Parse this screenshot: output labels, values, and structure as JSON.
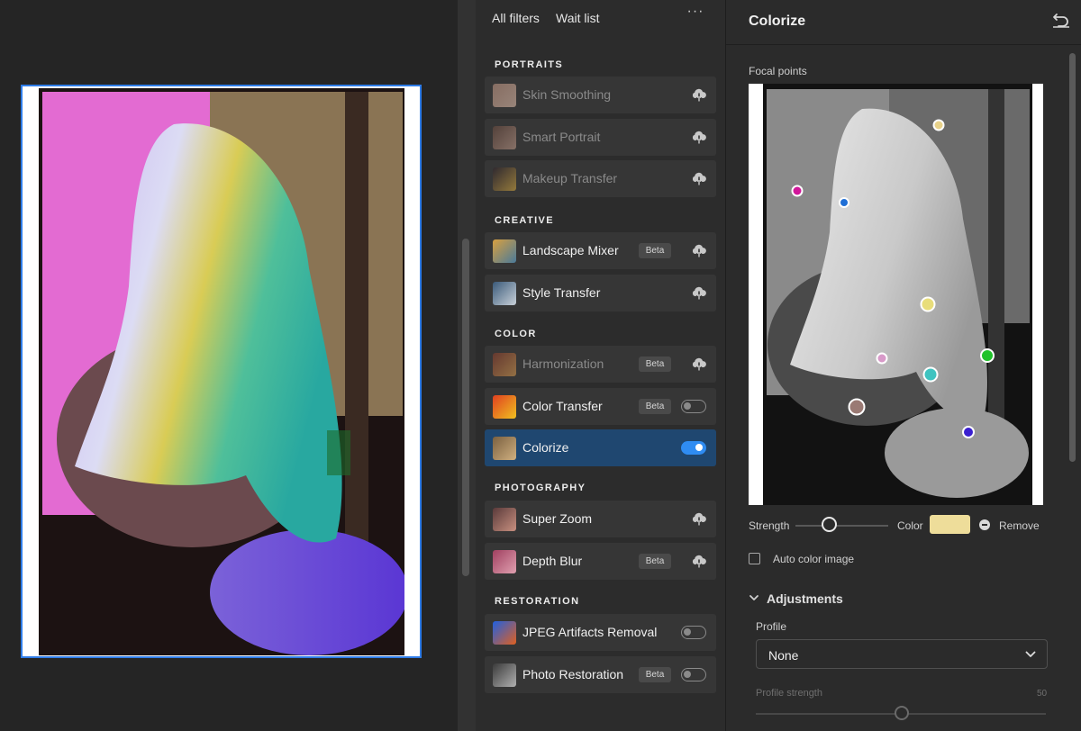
{
  "filters_panel": {
    "tabs": [
      "All filters",
      "Wait list"
    ],
    "more_label": "···",
    "sections": [
      {
        "label": "PORTRAITS",
        "items": [
          {
            "name": "Skin Smoothing",
            "beta": false,
            "control": "cloud",
            "state": "disabled"
          },
          {
            "name": "Smart Portrait",
            "beta": false,
            "control": "cloud",
            "state": "disabled"
          },
          {
            "name": "Makeup Transfer",
            "beta": false,
            "control": "cloud",
            "state": "disabled"
          }
        ]
      },
      {
        "label": "CREATIVE",
        "items": [
          {
            "name": "Landscape Mixer",
            "beta": true,
            "control": "cloud",
            "state": "enabled"
          },
          {
            "name": "Style Transfer",
            "beta": false,
            "control": "cloud",
            "state": "enabled"
          }
        ]
      },
      {
        "label": "COLOR",
        "items": [
          {
            "name": "Harmonization",
            "beta": true,
            "control": "cloud",
            "state": "disabled"
          },
          {
            "name": "Color Transfer",
            "beta": true,
            "control": "toggle",
            "toggle_on": false,
            "state": "enabled"
          },
          {
            "name": "Colorize",
            "beta": false,
            "control": "toggle",
            "toggle_on": true,
            "state": "active"
          }
        ]
      },
      {
        "label": "PHOTOGRAPHY",
        "items": [
          {
            "name": "Super Zoom",
            "beta": false,
            "control": "cloud",
            "state": "enabled"
          },
          {
            "name": "Depth Blur",
            "beta": true,
            "control": "cloud",
            "state": "enabled"
          }
        ]
      },
      {
        "label": "RESTORATION",
        "items": [
          {
            "name": "JPEG Artifacts Removal",
            "beta": false,
            "control": "toggle",
            "toggle_on": false,
            "state": "enabled"
          },
          {
            "name": "Photo Restoration",
            "beta": true,
            "control": "toggle",
            "toggle_on": false,
            "state": "enabled"
          }
        ]
      }
    ],
    "beta_label": "Beta"
  },
  "colorize_panel": {
    "title": "Colorize",
    "focal_points_label": "Focal points",
    "focal_points": [
      {
        "color": "#e8d28a"
      },
      {
        "color": "#d1169a"
      },
      {
        "color": "#1f6fd6"
      },
      {
        "color": "#e8dd7a"
      },
      {
        "color": "#d89ac9"
      },
      {
        "color": "#3fc3c0"
      },
      {
        "color": "#20c22a"
      },
      {
        "color": "#9a7a74"
      },
      {
        "color": "#3a1fd0"
      }
    ],
    "strength_label": "Strength",
    "strength_level": 0.36,
    "color_label": "Color",
    "selected_color": "#eedd9a",
    "remove_label": "Remove",
    "auto_color_label": "Auto color image",
    "auto_color_checked": false,
    "adjustments_label": "Adjustments",
    "profile_label": "Profile",
    "profile_value": "None",
    "profile_strength_label": "Profile strength",
    "profile_strength_value": "50"
  },
  "colors": {
    "accent": "#2f8cf2",
    "active_row": "#1f4770",
    "selection_border": "#2e7ce8"
  }
}
